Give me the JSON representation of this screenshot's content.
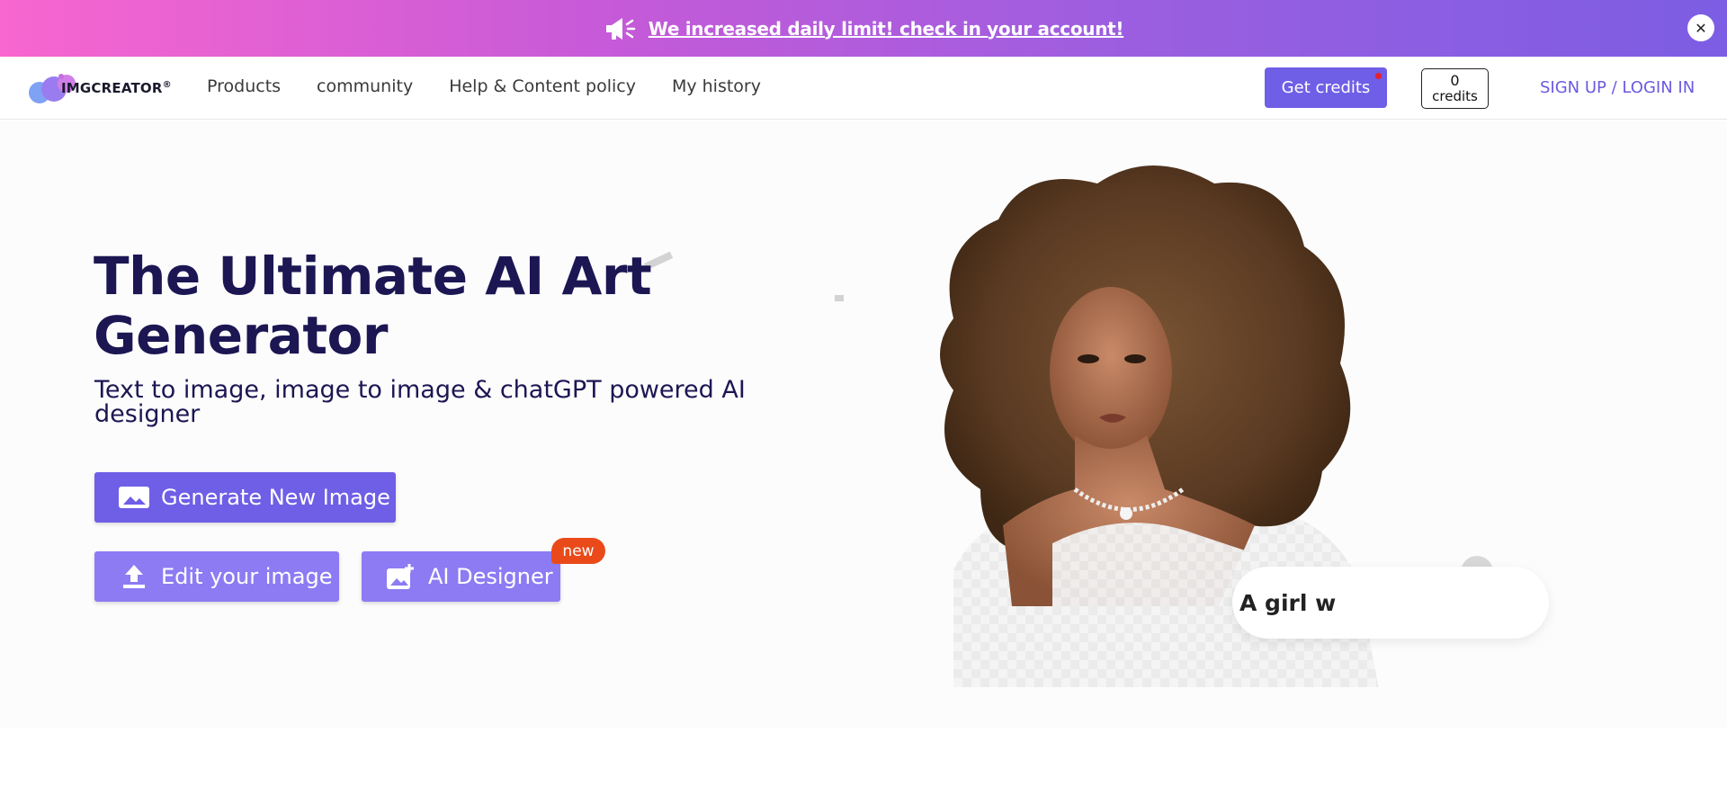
{
  "banner": {
    "message": "We increased daily limit! check in your account!",
    "close_symbol": "✕",
    "icon": "megaphone-icon",
    "gradient": [
      "#f866cf",
      "#7c5de3"
    ]
  },
  "header": {
    "logo_text": "IMGCREATOR",
    "logo_mark": "®",
    "nav": [
      {
        "label": "Products"
      },
      {
        "label": "community"
      },
      {
        "label": "Help & Content policy"
      },
      {
        "label": "My history"
      }
    ],
    "get_credits_label": "Get credits",
    "credits_count": "0",
    "credits_label": "credits",
    "auth_label": "SIGN UP / LOGIN IN"
  },
  "hero": {
    "title": "The Ultimate AI Art Generator",
    "subtitle": "Text to image, image to image & chatGPT powered AI designer",
    "generate_label": "Generate New Image",
    "edit_label": "Edit your image",
    "ai_designer_label": "AI Designer",
    "new_badge": "new",
    "prompt_text": "A girl w"
  },
  "colors": {
    "accent": "#6f5ee6",
    "accent_light": "#8c7bf3",
    "title": "#1c1653",
    "badge": "#ea4a1a"
  }
}
